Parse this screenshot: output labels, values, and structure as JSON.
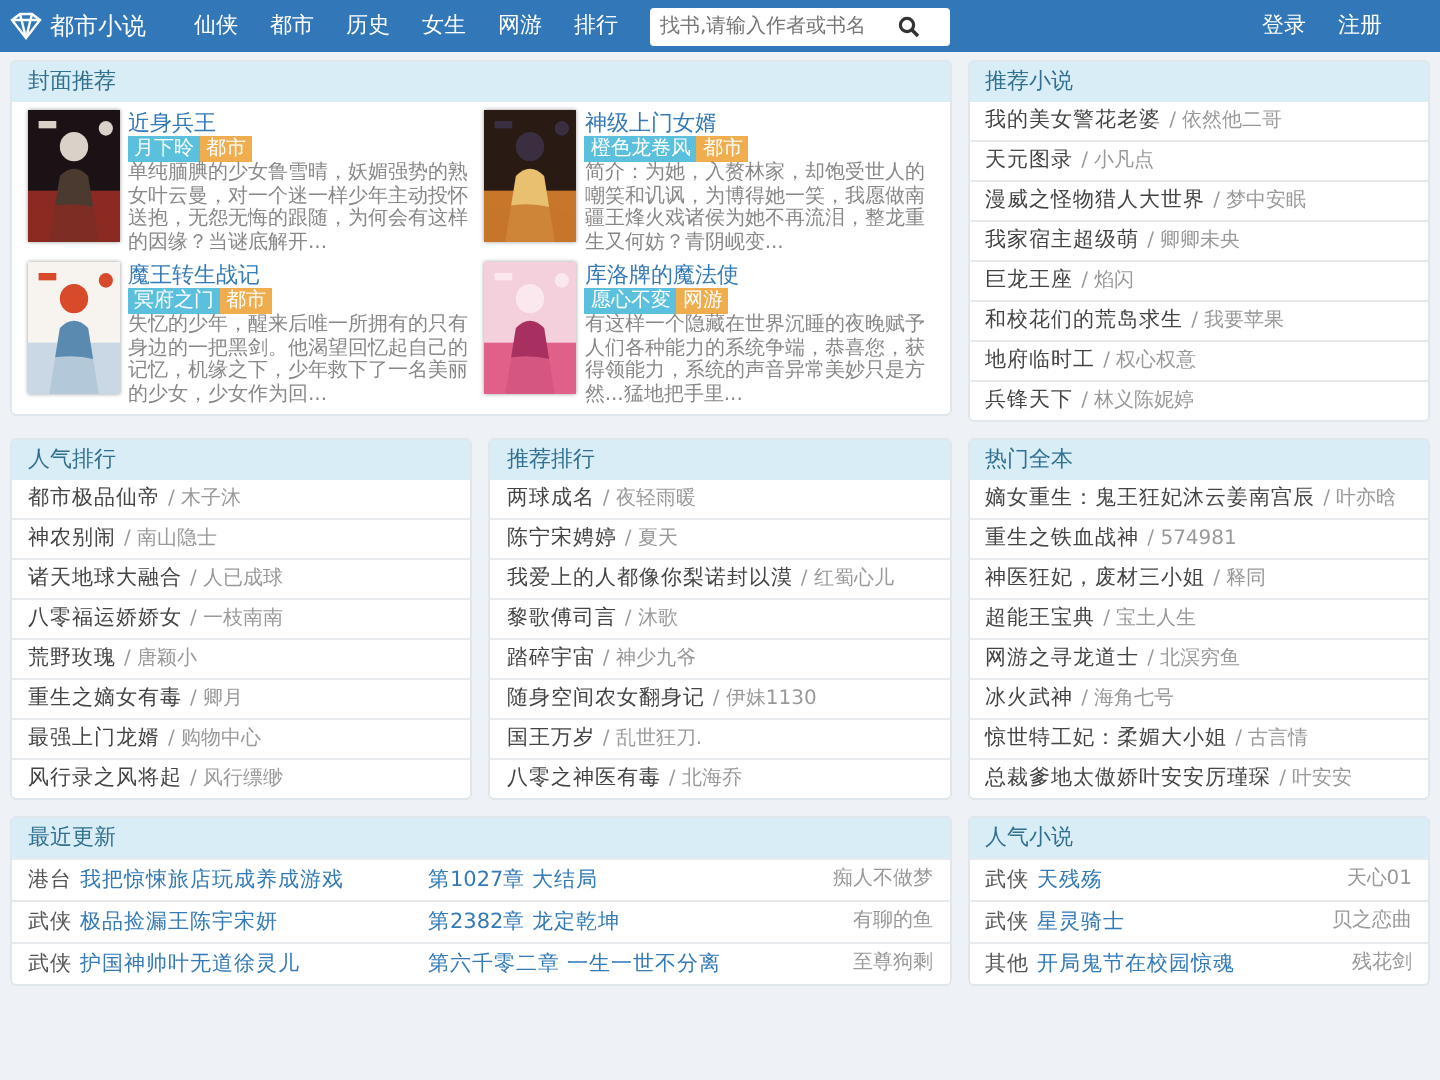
{
  "navbar": {
    "brand": "都市小说",
    "links": [
      "仙侠",
      "都市",
      "历史",
      "女生",
      "网游",
      "排行"
    ],
    "search": {
      "placeholder": "找书,请输入作者或书名"
    },
    "account": [
      "登录",
      "注册"
    ]
  },
  "cover_panel": {
    "title": "封面推荐",
    "books": [
      {
        "title": "近身兵王",
        "author": "月下昤",
        "genre": "都市",
        "description": "单纯腼腆的少女鲁雪晴，妖媚强势的熟女叶云曼，对一个迷一样少年主动投怀送抱，无怨无悔的跟随，为何会有这样的因缘？当谜底解开..."
      },
      {
        "title": "神级上门女婿",
        "author": "橙色龙卷风",
        "genre": "都市",
        "description": "简介：为她，入赘林家，却饱受世人的嘲笑和讥讽，为博得她一笑，我愿做南疆王烽火戏诸侯为她不再流泪，整龙重生又何妨？青阴岘变..."
      },
      {
        "title": "魔王转生战记",
        "author": "冥府之门",
        "genre": "都市",
        "description": "失忆的少年，醒来后唯一所拥有的只有身边的一把黑剑。他渴望回忆起自己的记忆，机缘之下，少年救下了一名美丽的少女，少女作为回..."
      },
      {
        "title": "库洛牌的魔法使",
        "author": "愿心不変",
        "genre": "网游",
        "description": "有这样一个隐藏在世界沉睡的夜晚赋予人们各种能力的系统争端，恭喜您，获得领能力，系统的声音异常美妙只是方然...猛地把手里..."
      }
    ]
  },
  "lists": [
    {
      "title": "推荐小说",
      "items": [
        {
          "title": "我的美女警花老婆",
          "author": "/ 依然他二哥"
        },
        {
          "title": "天元图录",
          "author": "/ 小凡点"
        },
        {
          "title": "漫威之怪物猎人大世界",
          "author": "/ 梦中安眠"
        },
        {
          "title": "我家宿主超级萌",
          "author": "/ 卿卿未央"
        },
        {
          "title": "巨龙王座",
          "author": "/ 焰闪"
        },
        {
          "title": "和校花们的荒岛求生",
          "author": "/ 我要苹果"
        },
        {
          "title": "地府临时工",
          "author": "/ 权心权意"
        },
        {
          "title": "兵锋天下",
          "author": "/ 林义陈妮婷"
        }
      ]
    },
    {
      "title": "人气排行",
      "items": [
        {
          "title": "都市极品仙帝",
          "author": "/ 木子沐"
        },
        {
          "title": "神农别闹",
          "author": "/ 南山隐士"
        },
        {
          "title": "诸天地球大融合",
          "author": "/ 人已成球"
        },
        {
          "title": "八零福运娇娇女",
          "author": "/ 一枝南南"
        },
        {
          "title": "荒野玫瑰",
          "author": "/ 唐颖小"
        },
        {
          "title": "重生之嫡女有毒",
          "author": "/ 卿月"
        },
        {
          "title": "最强上门龙婿",
          "author": "/ 购物中心"
        },
        {
          "title": "风行录之风将起",
          "author": "/ 风行缥缈"
        }
      ]
    },
    {
      "title": "推荐排行",
      "items": [
        {
          "title": "两球成名",
          "author": "/ 夜轻雨暖"
        },
        {
          "title": "陈宁宋娉婷",
          "author": "/ 夏天"
        },
        {
          "title": "我爱上的人都像你梨诺封以漠",
          "author": "/ 红蜀心儿"
        },
        {
          "title": "黎歌傅司言",
          "author": "/ 沐歌"
        },
        {
          "title": "踏碎宇宙",
          "author": "/ 神少九爷"
        },
        {
          "title": "随身空间农女翻身记",
          "author": "/ 伊妹1130"
        },
        {
          "title": "国王万岁",
          "author": "/ 乱世狂刀."
        },
        {
          "title": "八零之神医有毒",
          "author": "/ 北海乔"
        }
      ]
    },
    {
      "title": "热门全本",
      "items": [
        {
          "title": "嫡女重生：鬼王狂妃沐云姜南宫辰",
          "author": "/ 叶亦晗"
        },
        {
          "title": "重生之铁血战神",
          "author": "/ 574981"
        },
        {
          "title": "神医狂妃，废材三小姐",
          "author": "/ 释同"
        },
        {
          "title": "超能王宝典",
          "author": "/ 宝土人生"
        },
        {
          "title": "网游之寻龙道士",
          "author": "/ 北溟穷鱼"
        },
        {
          "title": "冰火武神",
          "author": "/ 海角七号"
        },
        {
          "title": "惊世特工妃：柔媚大小姐",
          "author": "/ 古言情"
        },
        {
          "title": "总裁爹地太傲娇叶安安厉瑾琛",
          "author": "/ 叶安安"
        }
      ]
    }
  ],
  "recent_updates": {
    "title": "最近更新",
    "rows": [
      {
        "genre": "港台",
        "title": "我把惊悚旅店玩成养成游戏",
        "chapter": "第1027章 大结局",
        "author": "痴人不做梦"
      },
      {
        "genre": "武侠",
        "title": "极品捡漏王陈宇宋妍",
        "chapter": "第2382章 龙定乾坤",
        "author": "有聊的鱼"
      },
      {
        "genre": "武侠",
        "title": "护国神帅叶无道徐灵儿",
        "chapter": "第六千零二章 一生一世不分离",
        "author": "至尊狗剩"
      }
    ]
  },
  "popular": {
    "title": "人气小说",
    "rows": [
      {
        "genre": "武侠",
        "title": "天残殇",
        "author": "天心01"
      },
      {
        "genre": "武侠",
        "title": "星灵骑士",
        "author": "贝之恋曲"
      },
      {
        "genre": "其他",
        "title": "开局鬼节在校园惊魂",
        "author": "残花剑"
      }
    ]
  }
}
